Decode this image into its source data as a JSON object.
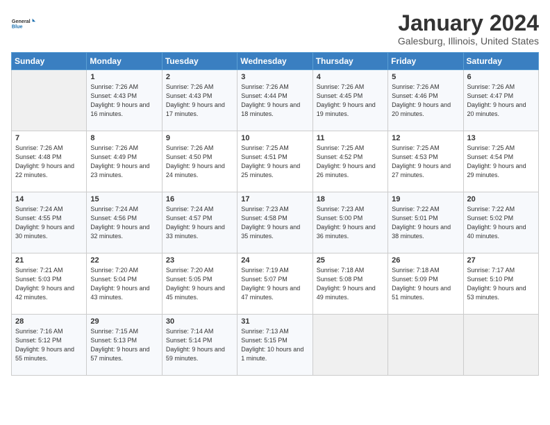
{
  "header": {
    "title": "January 2024",
    "subtitle": "Galesburg, Illinois, United States"
  },
  "logo": {
    "line1": "General",
    "line2": "Blue"
  },
  "days_of_week": [
    "Sunday",
    "Monday",
    "Tuesday",
    "Wednesday",
    "Thursday",
    "Friday",
    "Saturday"
  ],
  "weeks": [
    [
      {
        "day": null
      },
      {
        "day": 1,
        "sunrise": "7:26 AM",
        "sunset": "4:43 PM",
        "daylight": "9 hours and 16 minutes."
      },
      {
        "day": 2,
        "sunrise": "7:26 AM",
        "sunset": "4:43 PM",
        "daylight": "9 hours and 17 minutes."
      },
      {
        "day": 3,
        "sunrise": "7:26 AM",
        "sunset": "4:44 PM",
        "daylight": "9 hours and 18 minutes."
      },
      {
        "day": 4,
        "sunrise": "7:26 AM",
        "sunset": "4:45 PM",
        "daylight": "9 hours and 19 minutes."
      },
      {
        "day": 5,
        "sunrise": "7:26 AM",
        "sunset": "4:46 PM",
        "daylight": "9 hours and 20 minutes."
      },
      {
        "day": 6,
        "sunrise": "7:26 AM",
        "sunset": "4:47 PM",
        "daylight": "9 hours and 20 minutes."
      }
    ],
    [
      {
        "day": 7,
        "sunrise": "7:26 AM",
        "sunset": "4:48 PM",
        "daylight": "9 hours and 22 minutes."
      },
      {
        "day": 8,
        "sunrise": "7:26 AM",
        "sunset": "4:49 PM",
        "daylight": "9 hours and 23 minutes."
      },
      {
        "day": 9,
        "sunrise": "7:26 AM",
        "sunset": "4:50 PM",
        "daylight": "9 hours and 24 minutes."
      },
      {
        "day": 10,
        "sunrise": "7:25 AM",
        "sunset": "4:51 PM",
        "daylight": "9 hours and 25 minutes."
      },
      {
        "day": 11,
        "sunrise": "7:25 AM",
        "sunset": "4:52 PM",
        "daylight": "9 hours and 26 minutes."
      },
      {
        "day": 12,
        "sunrise": "7:25 AM",
        "sunset": "4:53 PM",
        "daylight": "9 hours and 27 minutes."
      },
      {
        "day": 13,
        "sunrise": "7:25 AM",
        "sunset": "4:54 PM",
        "daylight": "9 hours and 29 minutes."
      }
    ],
    [
      {
        "day": 14,
        "sunrise": "7:24 AM",
        "sunset": "4:55 PM",
        "daylight": "9 hours and 30 minutes."
      },
      {
        "day": 15,
        "sunrise": "7:24 AM",
        "sunset": "4:56 PM",
        "daylight": "9 hours and 32 minutes."
      },
      {
        "day": 16,
        "sunrise": "7:24 AM",
        "sunset": "4:57 PM",
        "daylight": "9 hours and 33 minutes."
      },
      {
        "day": 17,
        "sunrise": "7:23 AM",
        "sunset": "4:58 PM",
        "daylight": "9 hours and 35 minutes."
      },
      {
        "day": 18,
        "sunrise": "7:23 AM",
        "sunset": "5:00 PM",
        "daylight": "9 hours and 36 minutes."
      },
      {
        "day": 19,
        "sunrise": "7:22 AM",
        "sunset": "5:01 PM",
        "daylight": "9 hours and 38 minutes."
      },
      {
        "day": 20,
        "sunrise": "7:22 AM",
        "sunset": "5:02 PM",
        "daylight": "9 hours and 40 minutes."
      }
    ],
    [
      {
        "day": 21,
        "sunrise": "7:21 AM",
        "sunset": "5:03 PM",
        "daylight": "9 hours and 42 minutes."
      },
      {
        "day": 22,
        "sunrise": "7:20 AM",
        "sunset": "5:04 PM",
        "daylight": "9 hours and 43 minutes."
      },
      {
        "day": 23,
        "sunrise": "7:20 AM",
        "sunset": "5:05 PM",
        "daylight": "9 hours and 45 minutes."
      },
      {
        "day": 24,
        "sunrise": "7:19 AM",
        "sunset": "5:07 PM",
        "daylight": "9 hours and 47 minutes."
      },
      {
        "day": 25,
        "sunrise": "7:18 AM",
        "sunset": "5:08 PM",
        "daylight": "9 hours and 49 minutes."
      },
      {
        "day": 26,
        "sunrise": "7:18 AM",
        "sunset": "5:09 PM",
        "daylight": "9 hours and 51 minutes."
      },
      {
        "day": 27,
        "sunrise": "7:17 AM",
        "sunset": "5:10 PM",
        "daylight": "9 hours and 53 minutes."
      }
    ],
    [
      {
        "day": 28,
        "sunrise": "7:16 AM",
        "sunset": "5:12 PM",
        "daylight": "9 hours and 55 minutes."
      },
      {
        "day": 29,
        "sunrise": "7:15 AM",
        "sunset": "5:13 PM",
        "daylight": "9 hours and 57 minutes."
      },
      {
        "day": 30,
        "sunrise": "7:14 AM",
        "sunset": "5:14 PM",
        "daylight": "9 hours and 59 minutes."
      },
      {
        "day": 31,
        "sunrise": "7:13 AM",
        "sunset": "5:15 PM",
        "daylight": "10 hours and 1 minute."
      },
      {
        "day": null
      },
      {
        "day": null
      },
      {
        "day": null
      }
    ]
  ]
}
